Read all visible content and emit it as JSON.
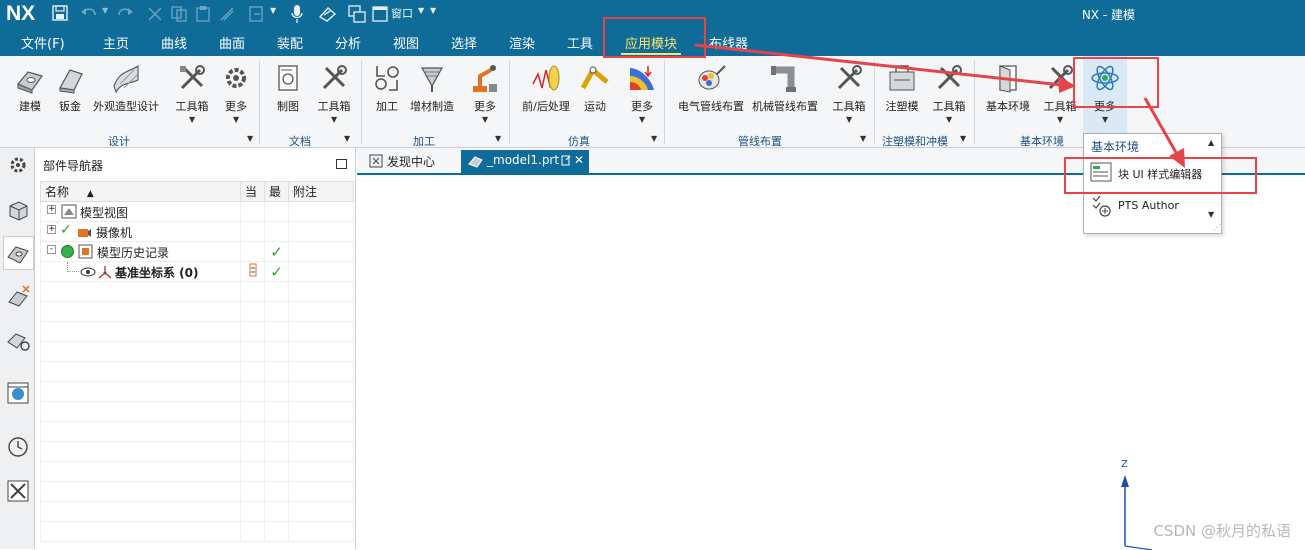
{
  "titlebar": {
    "logo": "NX",
    "window_menu": "窗口",
    "title": "NX - 建模"
  },
  "menu": {
    "items": [
      "文件(F)",
      "主页",
      "曲线",
      "曲面",
      "装配",
      "分析",
      "视图",
      "选择",
      "渲染",
      "工具",
      "应用模块",
      "布线器"
    ],
    "active": "应用模块"
  },
  "ribbon": {
    "buttons": [
      "建模",
      "钣金",
      "外观造型设计",
      "工具箱",
      "更多",
      "制图",
      "工具箱",
      "加工",
      "增材制造",
      "更多",
      "前/后处理",
      "运动",
      "更多",
      "电气管线布置",
      "机械管线布置",
      "工具箱",
      "注塑模",
      "工具箱",
      "基本环境",
      "工具箱",
      "更多"
    ],
    "groups": [
      "设计",
      "文档",
      "加工",
      "仿真",
      "管线布置",
      "注塑模和冲模",
      "基本环境"
    ]
  },
  "navigator": {
    "title": "部件导航器",
    "columns": [
      "名称",
      "当",
      "最",
      "附注"
    ],
    "rows": [
      {
        "name": "模型视图",
        "expand": "+"
      },
      {
        "name": "摄像机",
        "expand": "+"
      },
      {
        "name": "模型历史记录",
        "expand": "-"
      },
      {
        "name": "基准坐标系 (0)",
        "expand": ""
      }
    ]
  },
  "tabs": {
    "discover": "发现中心",
    "model": "_model1.prt"
  },
  "dropdown": {
    "header": "基本环境",
    "items": [
      "块 UI 样式编辑器",
      "PTS Author"
    ]
  },
  "axis": {
    "z": "Z"
  },
  "watermark": "CSDN @秋月的私语",
  "colors": {
    "accent": "#0f6c98",
    "highlight": "#ffe36b",
    "annotation_red": "#e8434a",
    "check_green": "#2aa52a"
  }
}
